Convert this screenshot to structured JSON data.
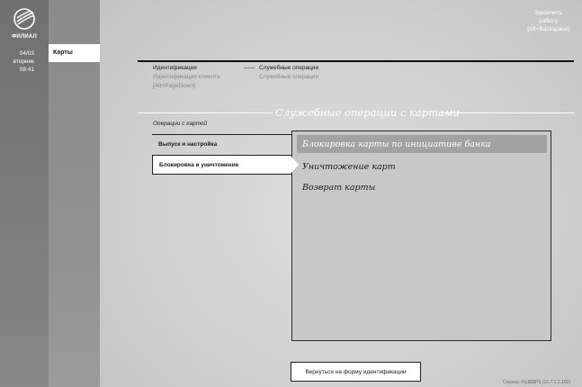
{
  "brand": {
    "name": "ФИЛИАЛ"
  },
  "datetime": {
    "date": "04/03",
    "weekday": "вторник",
    "time": "08:41"
  },
  "nav": {
    "active_item": "Карты"
  },
  "header": {
    "finish_line1": "Закончить",
    "finish_line2": "работу",
    "finish_line3": "[Alt+Backspace]"
  },
  "breadcrumb": {
    "step1_title": "Идентификация",
    "step1_sub": "Идентификация клиента",
    "step1_hotkey": "[Alt+PageDown]",
    "step2_title": "Служебные операции",
    "step2_sub": "Служебные операции"
  },
  "section": {
    "title": "Служебные операции с картами",
    "ops_label": "Операции с картой"
  },
  "operations": [
    "Выпуск и настройка",
    "Блокировка и уничтожение"
  ],
  "panel_items": [
    "Блокировка карты по инициативе банка",
    "Уничтожение карт",
    "Возврат карты"
  ],
  "footer": {
    "back_button": "Вернуться на форму идентификации",
    "server": "Сервер: FIL$$$PS (10.7.1.2.160)"
  },
  "colors": {
    "sidebar": "#77787b",
    "highlight": "#a2a2a4",
    "panel": "#c8c8ca"
  }
}
